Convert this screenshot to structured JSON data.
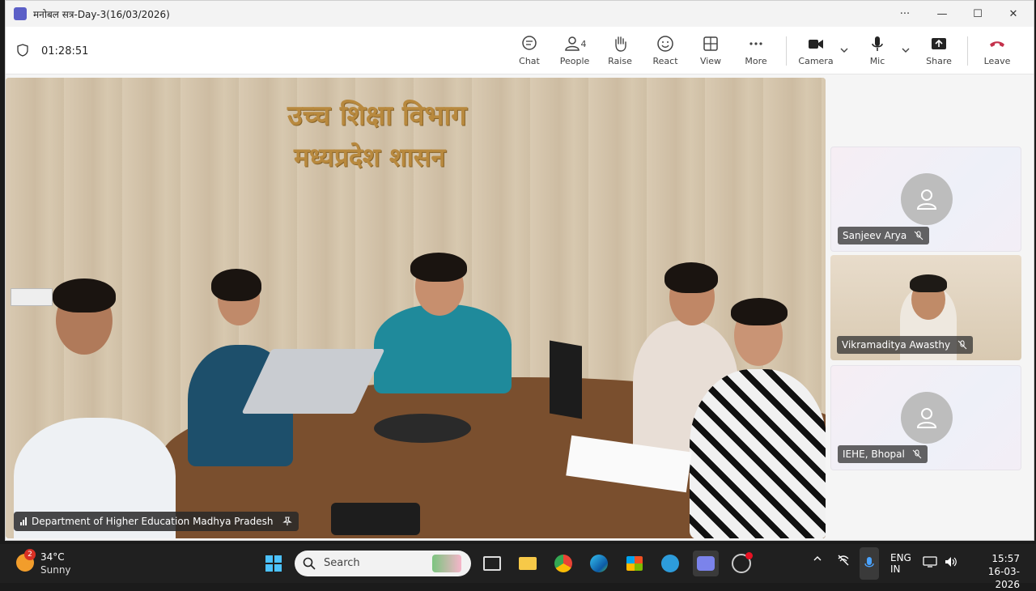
{
  "window": {
    "title": "मनोबल सत्र-Day-3(16/03/2026)",
    "more": "···",
    "minimize": "—",
    "maximize": "☐",
    "close": "✕"
  },
  "toolbar": {
    "timer": "01:28:51",
    "chat": "Chat",
    "people": "People",
    "people_count": "4",
    "raise": "Raise",
    "react": "React",
    "view": "View",
    "more": "More",
    "camera": "Camera",
    "mic": "Mic",
    "share": "Share",
    "leave": "Leave",
    "leave_color": "#c4314b"
  },
  "stage": {
    "wall_text_1": "उच्च शिक्षा विभाग",
    "wall_text_2": "मध्यप्रदेश शासन",
    "caption": "Department of Higher Education Madhya Pradesh"
  },
  "participants": [
    {
      "name": "Sanjeev Arya",
      "video": false,
      "muted": true
    },
    {
      "name": "Vikramaditya Awasthy",
      "video": true,
      "muted": true
    },
    {
      "name": "IEHE, Bhopal",
      "video": false,
      "muted": true
    }
  ],
  "taskbar": {
    "weather_badge": "2",
    "temperature": "34°C",
    "condition": "Sunny",
    "search_placeholder": "Search",
    "lang_1": "ENG",
    "lang_2": "IN",
    "time": "15:57",
    "date": "16-03-2026"
  },
  "colors": {
    "accent": "#5b5fc7",
    "taskbar": "#202020",
    "mic_active": "#4aa3ff"
  }
}
